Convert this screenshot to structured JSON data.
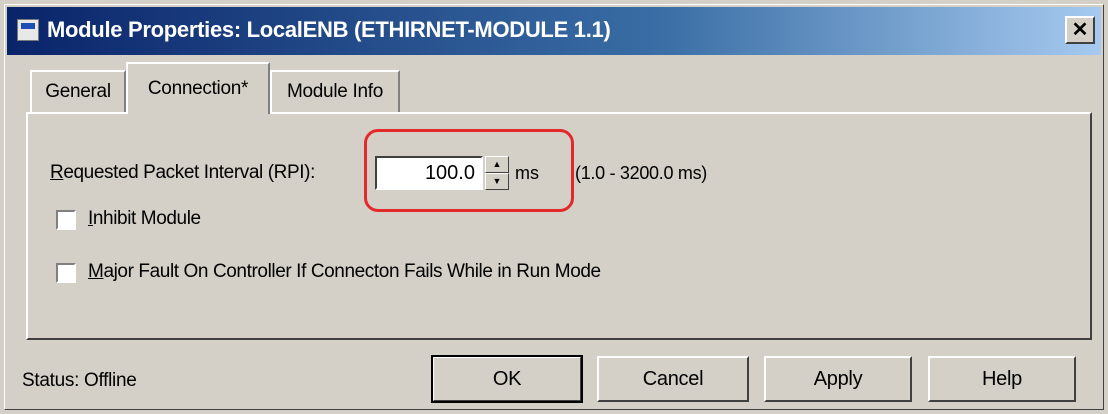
{
  "window": {
    "title": "Module Properties: LocalENB (ETHIRNET-MODULE 1.1)",
    "close_glyph": "✕"
  },
  "tabs": [
    {
      "label": "General",
      "active": false
    },
    {
      "label": "Connection*",
      "active": true
    },
    {
      "label": "Module Info",
      "active": false
    }
  ],
  "connection": {
    "rpi_label_first": "R",
    "rpi_label_rest": "equested Packet Interval (RPI):",
    "rpi_value": "100.0",
    "rpi_unit": "ms",
    "rpi_range": "(1.0 - 3200.0 ms)",
    "inhibit_first": "I",
    "inhibit_rest": "nhibit Module",
    "inhibit_checked": false,
    "major_fault_first": "M",
    "major_fault_rest": "ajor Fault On Controller If Connecton Fails While in Run Mode",
    "major_fault_checked": false
  },
  "status": {
    "text": "Status:  Offline"
  },
  "buttons": {
    "ok": "OK",
    "cancel": "Cancel",
    "apply": "Apply",
    "help": "Help"
  },
  "icons": {
    "window_icon": "module-window-icon",
    "spin_up": "▲",
    "spin_down": "▼"
  },
  "colors": {
    "highlight": "#e32a2a",
    "titlebar": "#0a246a"
  }
}
